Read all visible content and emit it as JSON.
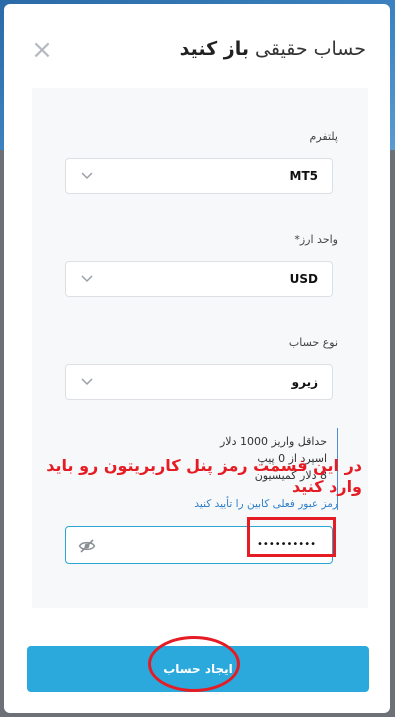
{
  "modal": {
    "title_light": "حساب حقیقی",
    "title_bold": "باز کنید",
    "close_symbol": "×"
  },
  "form": {
    "platform": {
      "label": "پلتفرم",
      "value": "MT5"
    },
    "currency": {
      "label": "واحد ارز*",
      "value": "USD"
    },
    "account_type": {
      "label": "نوع حساب",
      "value": "زیرو"
    },
    "info": {
      "line1": "حداقل واریز 1000 دلار",
      "line2": "اسپرد از 0 پیپ",
      "line3": "8 دلار کمیسیون"
    },
    "confirm_note": "رمز عبور فعلی کابین را تأیید کنید",
    "password": {
      "masked_value": "••••••••••"
    },
    "submit_label": "ایجاد حساب"
  },
  "annotation": {
    "text": "در این قسمت رمز پنل کاربریتون رو باید وارد کنید",
    "color": "#e51c23"
  },
  "colors": {
    "accent": "#2ba8dc",
    "link": "#2f7fc9"
  }
}
